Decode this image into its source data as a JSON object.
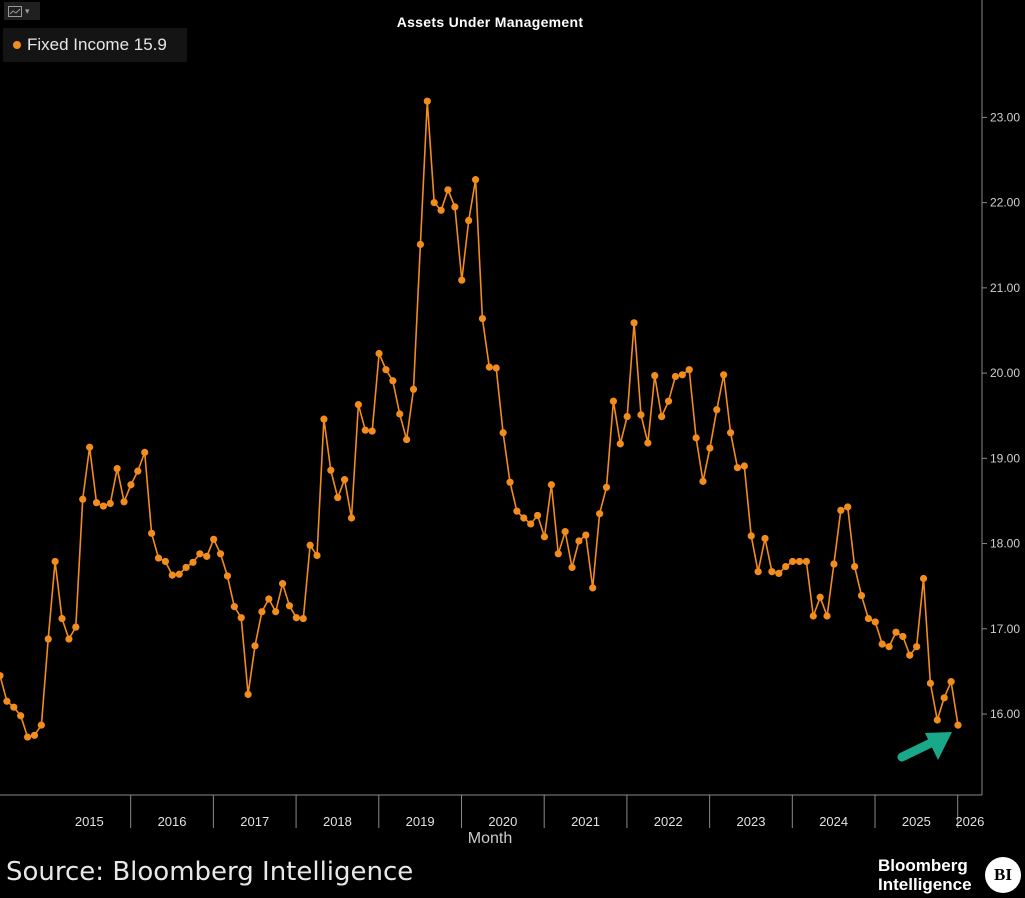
{
  "toolbar": {
    "chart_type_icon": "line-chart-icon",
    "caret_icon": "caret-down-icon"
  },
  "legend": {
    "label": "Fixed Income 15.9"
  },
  "footer": {
    "source": "Source: Bloomberg Intelligence",
    "brand_line1": "Bloomberg",
    "brand_line2": "Intelligence",
    "badge": "BI"
  },
  "colors": {
    "series": "#f28c1c",
    "axis": "#8a8a8a",
    "annotation_arrow": "#19a98a",
    "background": "#000000"
  },
  "chart_data": {
    "type": "line",
    "title": "Assets Under Management",
    "xlabel": "Month",
    "ylabel": "",
    "x_ticks": [
      "2015",
      "2016",
      "2017",
      "2018",
      "2019",
      "2020",
      "2021",
      "2022",
      "2023",
      "2024",
      "2025",
      "2026"
    ],
    "y_ticks": [
      "16.00",
      "17.00",
      "18.00",
      "19.00",
      "20.00",
      "21.00",
      "22.00",
      "23.00"
    ],
    "ylim": [
      15.05,
      23.65
    ],
    "x_start_year": 2014.42,
    "y_axis_position": "right",
    "grid": false,
    "legend_position": "top-left",
    "annotation": "arrow pointing to last data point",
    "series": [
      {
        "name": "Fixed Income",
        "last_value": 15.9,
        "values": [
          16.45,
          16.15,
          16.08,
          15.98,
          15.73,
          15.75,
          15.87,
          16.88,
          17.79,
          17.12,
          16.88,
          17.02,
          18.52,
          19.13,
          18.48,
          18.44,
          18.47,
          18.88,
          18.49,
          18.69,
          18.85,
          19.07,
          18.12,
          17.83,
          17.79,
          17.63,
          17.64,
          17.72,
          17.78,
          17.88,
          17.85,
          18.05,
          17.88,
          17.62,
          17.26,
          17.13,
          16.23,
          16.8,
          17.2,
          17.35,
          17.2,
          17.53,
          17.27,
          17.13,
          17.12,
          17.98,
          17.86,
          19.46,
          18.86,
          18.54,
          18.75,
          18.3,
          19.63,
          19.33,
          19.32,
          20.23,
          20.04,
          19.91,
          19.52,
          19.22,
          19.81,
          21.51,
          23.19,
          22.0,
          21.91,
          22.15,
          21.95,
          21.09,
          21.79,
          22.27,
          20.64,
          20.07,
          20.06,
          19.3,
          18.72,
          18.38,
          18.3,
          18.23,
          18.33,
          18.08,
          18.69,
          17.88,
          18.14,
          17.72,
          18.03,
          18.1,
          17.48,
          18.35,
          18.66,
          19.67,
          19.17,
          19.49,
          20.59,
          19.51,
          19.18,
          19.97,
          19.49,
          19.67,
          19.96,
          19.98,
          20.04,
          19.24,
          18.73,
          19.12,
          19.57,
          19.98,
          19.3,
          18.89,
          18.91,
          18.09,
          17.67,
          18.06,
          17.67,
          17.65,
          17.73,
          17.79,
          17.79,
          17.79,
          17.15,
          17.37,
          17.15,
          17.76,
          18.39,
          18.43,
          17.73,
          17.39,
          17.12,
          17.08,
          16.82,
          16.79,
          16.96,
          16.91,
          16.69,
          16.79,
          17.59,
          16.36,
          15.93,
          16.19,
          16.38,
          15.87
        ]
      }
    ]
  }
}
